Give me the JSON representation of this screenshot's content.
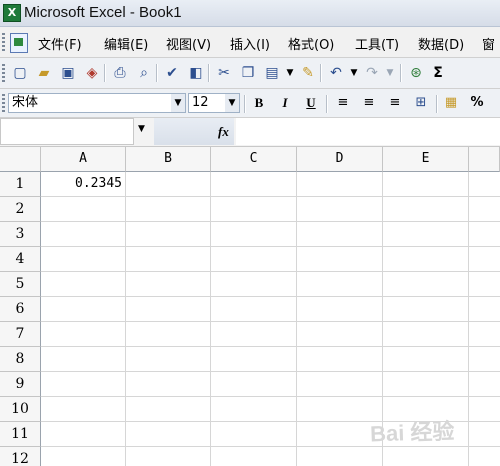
{
  "window": {
    "title": "Microsoft Excel - Book1"
  },
  "menubar": {
    "items": [
      {
        "label": "文件(F)"
      },
      {
        "label": "编辑(E)"
      },
      {
        "label": "视图(V)"
      },
      {
        "label": "插入(I)"
      },
      {
        "label": "格式(O)"
      },
      {
        "label": "工具(T)"
      },
      {
        "label": "数据(D)"
      },
      {
        "label": "窗"
      }
    ]
  },
  "format_toolbar": {
    "font_name": "宋体",
    "font_size": "12",
    "bold_label": "B",
    "italic_label": "I",
    "underline_label": "U",
    "percent_label": "%"
  },
  "formula_bar": {
    "name_box": "",
    "fx_label": "fx",
    "formula": ""
  },
  "sheet": {
    "columns": [
      "A",
      "B",
      "C",
      "D",
      "E"
    ],
    "rows": [
      "1",
      "2",
      "3",
      "4",
      "5",
      "6",
      "7",
      "8",
      "9",
      "10",
      "11",
      "12"
    ],
    "cells": {
      "A1": "0.2345"
    }
  },
  "watermark": "Bai 经验"
}
